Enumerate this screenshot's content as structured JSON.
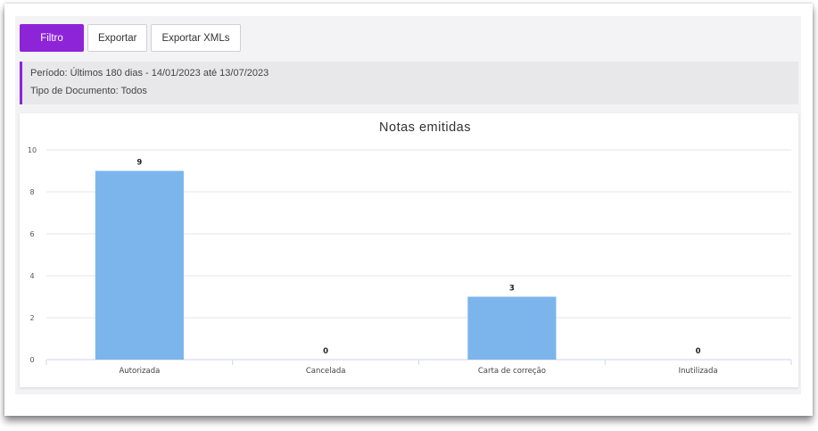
{
  "toolbar": {
    "filter_label": "Filtro",
    "export_label": "Exportar",
    "export_xml_label": "Exportar XMLs"
  },
  "info": {
    "period": "Período: Últimos 180 dias - 14/01/2023 até 13/07/2023",
    "doc_type": "Tipo de Documento: Todos"
  },
  "colors": {
    "accent": "#8e24d8",
    "bar": "#7cb5ec"
  },
  "chart_data": {
    "type": "bar",
    "title": "Notas emitidas",
    "categories": [
      "Autorizada",
      "Cancelada",
      "Carta de correção",
      "Inutilizada"
    ],
    "values": [
      9,
      0,
      3,
      0
    ],
    "ylim": [
      0,
      10
    ],
    "yticks": [
      0,
      2,
      4,
      6,
      8,
      10
    ],
    "grid": true,
    "legend": "none"
  }
}
